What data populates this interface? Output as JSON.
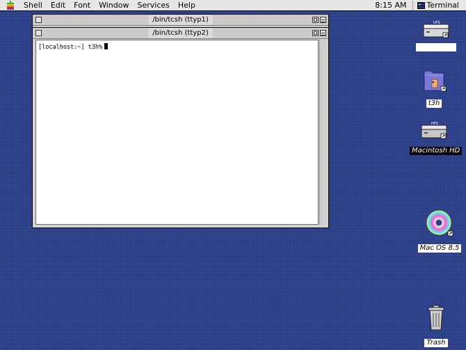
{
  "menubar": {
    "items": [
      "Shell",
      "Edit",
      "Font",
      "Window",
      "Services",
      "Help"
    ],
    "clock": "8:15 AM",
    "active_app": "Terminal"
  },
  "windows": [
    {
      "title": "/bin/tcsh (ttyp1)"
    },
    {
      "title": "/bin/tcsh (ttyp2)",
      "content": "[localhost:~] t3h%"
    }
  ],
  "desktop": {
    "disk_badges": {
      "ufs": "UFS",
      "hfs": "HFS"
    },
    "icons": [
      {
        "label": "",
        "icon": "ufs-disk-icon"
      },
      {
        "label": "t3h",
        "icon": "home-folder-icon"
      },
      {
        "label": "Macintosh HD",
        "icon": "hfs-disk-icon"
      },
      {
        "label": "Mac OS 8.5",
        "icon": "cd-icon"
      },
      {
        "label": "Trash",
        "icon": "trash-icon"
      }
    ]
  }
}
